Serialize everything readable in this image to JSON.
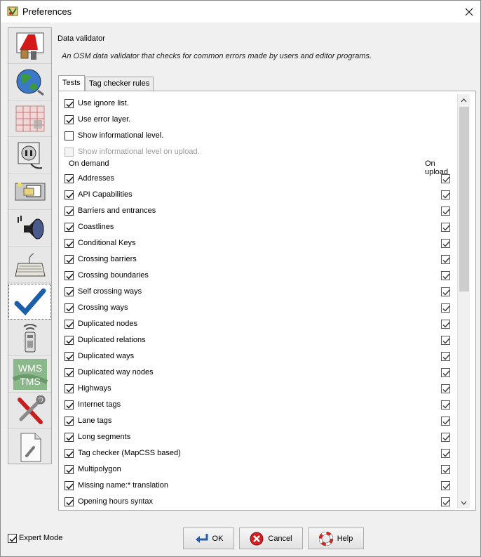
{
  "window": {
    "title": "Preferences"
  },
  "sidebar": {
    "items": [
      {
        "icon": "paint-brush-icon"
      },
      {
        "icon": "globe-icon"
      },
      {
        "icon": "map-grid-icon"
      },
      {
        "icon": "power-plug-icon"
      },
      {
        "icon": "folder-window-icon"
      },
      {
        "icon": "speaker-icon"
      },
      {
        "icon": "keyboard-icon"
      },
      {
        "icon": "checkmark-icon",
        "selected": true
      },
      {
        "icon": "remote-control-icon"
      },
      {
        "icon": "wms-tms-icon",
        "text_top": "WMS",
        "text_bottom": "TMS"
      },
      {
        "icon": "tools-icon"
      },
      {
        "icon": "document-wrench-icon"
      }
    ]
  },
  "section": {
    "title": "Data validator",
    "description": "An OSM data validator that checks for common errors made by users and editor programs."
  },
  "tabs": [
    {
      "label": "Tests",
      "active": true
    },
    {
      "label": "Tag checker rules",
      "active": false
    }
  ],
  "options": [
    {
      "label": "Use ignore list.",
      "checked": true,
      "enabled": true
    },
    {
      "label": "Use error layer.",
      "checked": true,
      "enabled": true
    },
    {
      "label": "Show informational level.",
      "checked": false,
      "enabled": true
    },
    {
      "label": "Show informational level on upload.",
      "checked": false,
      "enabled": false
    }
  ],
  "columns": {
    "left": "On demand",
    "right": "On upload"
  },
  "tests": [
    {
      "label": "Addresses",
      "on_demand": true,
      "on_upload": true
    },
    {
      "label": "API Capabilities",
      "on_demand": true,
      "on_upload": true
    },
    {
      "label": "Barriers and entrances",
      "on_demand": true,
      "on_upload": true
    },
    {
      "label": "Coastlines",
      "on_demand": true,
      "on_upload": true
    },
    {
      "label": "Conditional Keys",
      "on_demand": true,
      "on_upload": true
    },
    {
      "label": "Crossing barriers",
      "on_demand": true,
      "on_upload": true
    },
    {
      "label": "Crossing boundaries",
      "on_demand": true,
      "on_upload": true
    },
    {
      "label": "Self crossing ways",
      "on_demand": true,
      "on_upload": true
    },
    {
      "label": "Crossing ways",
      "on_demand": true,
      "on_upload": true
    },
    {
      "label": "Duplicated nodes",
      "on_demand": true,
      "on_upload": true
    },
    {
      "label": "Duplicated relations",
      "on_demand": true,
      "on_upload": true
    },
    {
      "label": "Duplicated ways",
      "on_demand": true,
      "on_upload": true
    },
    {
      "label": "Duplicated way nodes",
      "on_demand": true,
      "on_upload": true
    },
    {
      "label": "Highways",
      "on_demand": true,
      "on_upload": true
    },
    {
      "label": "Internet tags",
      "on_demand": true,
      "on_upload": true
    },
    {
      "label": "Lane tags",
      "on_demand": true,
      "on_upload": true
    },
    {
      "label": "Long segments",
      "on_demand": true,
      "on_upload": true
    },
    {
      "label": "Tag checker (MapCSS based)",
      "on_demand": true,
      "on_upload": true
    },
    {
      "label": "Multipolygon",
      "on_demand": true,
      "on_upload": true
    },
    {
      "label": "Missing name:* translation",
      "on_demand": true,
      "on_upload": true
    },
    {
      "label": "Opening hours syntax",
      "on_demand": true,
      "on_upload": true
    }
  ],
  "expert_mode": {
    "label": "Expert Mode",
    "checked": true
  },
  "buttons": {
    "ok": "OK",
    "cancel": "Cancel",
    "help": "Help"
  }
}
